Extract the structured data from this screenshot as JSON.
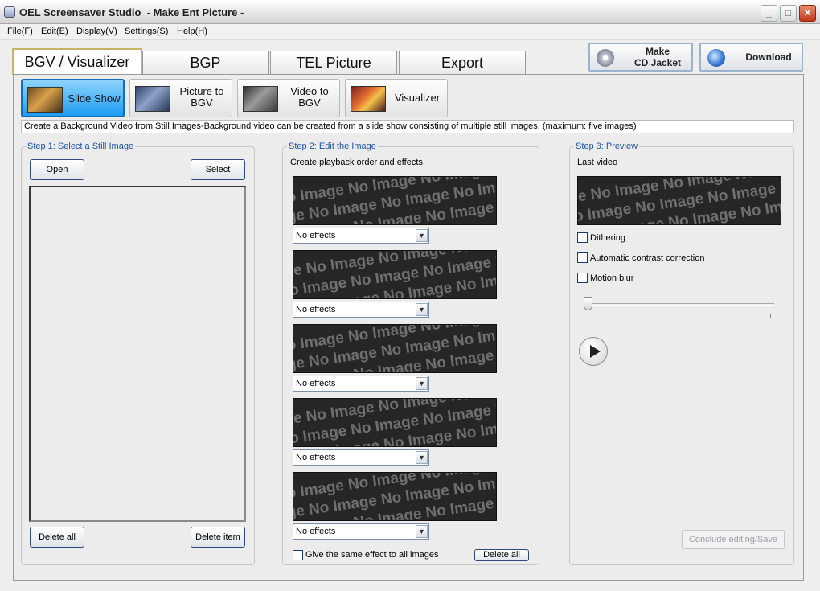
{
  "window": {
    "title": "OEL Screensaver Studio  - Make Ent Picture -",
    "min_label": "_",
    "max_label": "□",
    "close_label": "✕"
  },
  "menu": [
    "File(F)",
    "Edit(E)",
    "Display(V)",
    "Settings(S)",
    "Help(H)"
  ],
  "tabs": [
    "BGV / Visualizer",
    "BGP",
    "TEL Picture",
    "Export"
  ],
  "active_tab": "BGV / Visualizer",
  "top_buttons": {
    "cd_jacket": [
      "Make",
      "CD Jacket"
    ],
    "download": "Download"
  },
  "modes": [
    {
      "label": "Slide Show",
      "active": true
    },
    {
      "label": [
        "Picture to",
        "BGV"
      ],
      "active": false
    },
    {
      "label": [
        "Video to",
        "BGV"
      ],
      "active": false
    },
    {
      "label": "Visualizer",
      "active": false
    }
  ],
  "info_text": "Create a Background Video from Still Images-Background video can be created from a slide show consisting of multiple still images. (maximum: five images)",
  "step1": {
    "title": "Step 1: Select a Still Image",
    "open_label": "Open",
    "select_label": "Select",
    "delete_all_label": "Delete all",
    "delete_item_label": "Delete item"
  },
  "step2": {
    "title": "Step 2: Edit the Image",
    "description": "Create playback order and effects.",
    "placeholder_word": "No Image",
    "effects": [
      "No effects",
      "No effects",
      "No effects",
      "No effects",
      "No effects"
    ],
    "same_effect_label": "Give the same effect to all images",
    "delete_all_label": "Delete all"
  },
  "step3": {
    "title": "Step 3: Preview",
    "last_video_label": "Last video",
    "dithering_label": "Dithering",
    "contrast_label": "Automatic contrast correction",
    "motion_blur_label": "Motion blur",
    "slider_position": 0,
    "conclude_label": "Conclude editing/Save"
  },
  "colors": {
    "accent_active_mode": "#1d9cf0",
    "group_title": "#1e52a6",
    "close_button": "#c0391c"
  }
}
